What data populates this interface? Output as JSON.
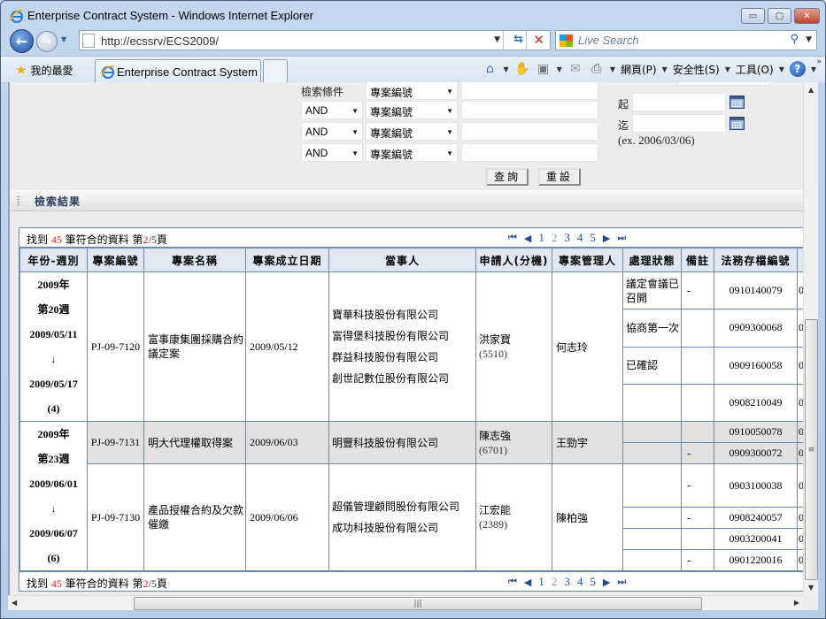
{
  "window": {
    "title": "Enterprise Contract System - Windows Internet Explorer",
    "minimize": "▭",
    "maximize": "▢",
    "close": "✕"
  },
  "nav": {
    "back": "←",
    "forward": "→",
    "url": "http://ecssrv/ECS2009/",
    "search_placeholder": "Live Search"
  },
  "tabbar": {
    "favorites": "我的最愛",
    "tab_title": "Enterprise Contract System",
    "menus": [
      "網頁(P)",
      "安全性(S)",
      "工具(O)"
    ]
  },
  "form": {
    "criteria_label": "檢索條件",
    "rows": [
      {
        "op": "",
        "field": "專案編號",
        "value": ""
      },
      {
        "op": "AND",
        "field": "專案編號",
        "value": ""
      },
      {
        "op": "AND",
        "field": "專案編號",
        "value": ""
      },
      {
        "op": "AND",
        "field": "專案編號",
        "value": ""
      }
    ],
    "query_button": "查詢",
    "reset_button": "重設",
    "from_label": "起",
    "to_label": "迄",
    "date_hint": "(ex. 2006/03/06)"
  },
  "results": {
    "section_title": "檢索結果",
    "found_prefix": "找到 ",
    "found_count": "45",
    "found_mid": " 筆符合的資料 第",
    "current_page": "2",
    "page_sep": "/",
    "total_pages": "5",
    "page_suffix": "頁",
    "pages": [
      "1",
      "2",
      "3",
      "4",
      "5"
    ],
    "columns": [
      "年份-週別",
      "專案編號",
      "專案名稱",
      "專案成立日期",
      "當事人",
      "申請人(分機)",
      "專案管理人",
      "處理狀態",
      "備註",
      "法務存檔編號",
      ""
    ],
    "groups": [
      {
        "year": "2009年",
        "week": "第20週",
        "start": "2009/05/11",
        "arrow": "↓",
        "end": "2009/05/17",
        "count": "(4)",
        "projects": [
          {
            "id": "PJ-09-7120",
            "name": "富事康集團採購合約議定案",
            "date": "2009/05/12",
            "parties": [
              "寶華科技股份有限公司",
              "富得堡科技股份有限公司",
              "群益科技股份有限公司",
              "創世記數位股份有限公司"
            ],
            "applicant": "洪家寶",
            "ext": "(5510)",
            "manager": "何志玲",
            "items": [
              {
                "status": "議定會議已召開",
                "note": "-",
                "archive": "0910140079",
                "extra": "0"
              },
              {
                "status": "協商第一次",
                "note": "",
                "archive": "0909300068",
                "extra": "0"
              },
              {
                "status": "已確認",
                "note": "",
                "archive": "0909160058",
                "extra": "0"
              },
              {
                "status": "",
                "note": "",
                "archive": "0908210049",
                "extra": "0"
              }
            ]
          }
        ]
      },
      {
        "year": "2009年",
        "week": "第23週",
        "start": "2009/06/01",
        "arrow": "↓",
        "end": "2009/06/07",
        "count": "(6)",
        "projects": [
          {
            "id": "PJ-09-7131",
            "name": "明大代理權取得案",
            "date": "2009/06/03",
            "parties": [
              "明豐科技股份有限公司"
            ],
            "applicant": "陳志強",
            "ext": "(6701)",
            "manager": "王勁宇",
            "items": [
              {
                "status": "",
                "note": "",
                "archive": "0910050078",
                "extra": "0"
              },
              {
                "status": "",
                "note": "-",
                "archive": "0909300072",
                "extra": "0"
              }
            ]
          },
          {
            "id": "PJ-09-7130",
            "name": "產品授權合約及欠款催繳",
            "date": "2009/06/06",
            "parties": [
              "超儀管理顧問股份有限公司",
              "成功科技股份有限公司"
            ],
            "applicant": "江宏能",
            "ext": "(2389)",
            "manager": "陳柏強",
            "items": [
              {
                "status": "",
                "note": "-",
                "archive": "0903100038",
                "extra": "0"
              },
              {
                "status": "",
                "note": "-",
                "archive": "0908240057",
                "extra": "0"
              },
              {
                "status": "",
                "note": "",
                "archive": "0903200041",
                "extra": "0"
              },
              {
                "status": "",
                "note": "-",
                "archive": "0901220016",
                "extra": "0"
              }
            ]
          }
        ]
      }
    ]
  }
}
